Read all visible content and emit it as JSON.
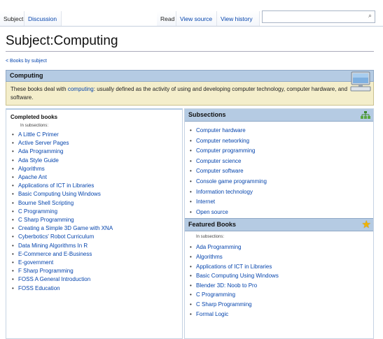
{
  "tabs": {
    "subject": "Subject",
    "discussion": "Discussion",
    "read": "Read",
    "view_source": "View source",
    "view_history": "View history"
  },
  "search": {
    "placeholder": "",
    "icon": "search-icon"
  },
  "page_title": "Subject:Computing",
  "back_link": "< Books by subject",
  "banner": {
    "title": "Computing",
    "text_before": "These books deal with ",
    "link": "computing",
    "text_after": ": usually defined as the activity of using and developing computer technology, computer hardware, and software."
  },
  "completed": {
    "heading": "Completed books",
    "in_subsections": "In subsections:",
    "items": [
      "A Little C Primer",
      "Active Server Pages",
      "Ada Programming",
      "Ada Style Guide",
      "Algorithms",
      "Apache Ant",
      "Applications of ICT in Libraries",
      "Basic Computing Using Windows",
      "Bourne Shell Scripting",
      "C Programming",
      "C Sharp Programming",
      "Creating a Simple 3D Game with XNA",
      "Cyberbotics' Robot Curriculum",
      "Data Mining Algorithms In R",
      "E-Commerce and E-Business",
      "E-government",
      "F Sharp Programming",
      "FOSS A General Introduction",
      "FOSS Education"
    ]
  },
  "subsections": {
    "heading": "Subsections",
    "items": [
      "Computer hardware",
      "Computer networking",
      "Computer programming",
      "Computer science",
      "Computer software",
      "Console game programming",
      "Information technology",
      "Internet",
      "Open source"
    ]
  },
  "featured": {
    "heading": "Featured Books",
    "in_subsections": "In subsections:",
    "items": [
      "Ada Programming",
      "Algorithms",
      "Applications of ICT in Libraries",
      "Basic Computing Using Windows",
      "Blender 3D: Noob to Pro",
      "C Programming",
      "C Sharp Programming",
      "Formal Logic"
    ]
  }
}
